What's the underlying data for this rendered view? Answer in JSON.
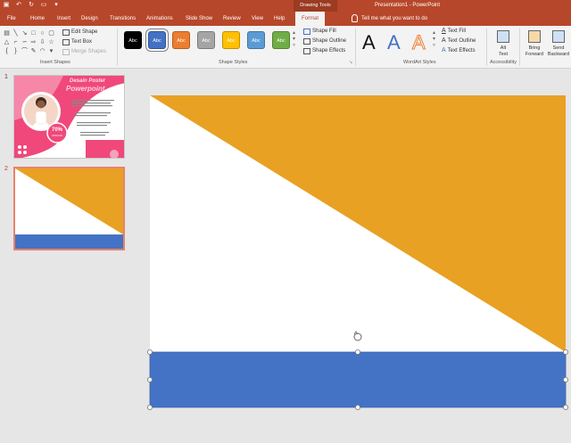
{
  "app": {
    "title": "Presentation1  -  PowerPoint",
    "context_tab_group": "Drawing Tools",
    "tell_me": "Tell me what you want to do"
  },
  "tabs": [
    {
      "label": "File"
    },
    {
      "label": "Home"
    },
    {
      "label": "Insert"
    },
    {
      "label": "Design"
    },
    {
      "label": "Transitions"
    },
    {
      "label": "Animations"
    },
    {
      "label": "Slide Show"
    },
    {
      "label": "Review"
    },
    {
      "label": "View"
    },
    {
      "label": "Help"
    },
    {
      "label": "Format"
    }
  ],
  "ribbon": {
    "insert_shapes": {
      "label": "Insert Shapes",
      "edit_shape": "Edit Shape",
      "text_box": "Text Box",
      "merge_shapes": "Merge Shapes"
    },
    "shape_styles": {
      "label": "Shape Styles",
      "swatch_text": "Abc",
      "swatches": [
        "#000000",
        "#4472c4",
        "#ed7d31",
        "#a5a5a5",
        "#ffc000",
        "#5b9bd5",
        "#70ad47"
      ],
      "shape_fill": "Shape Fill",
      "shape_outline": "Shape Outline",
      "shape_effects": "Shape Effects"
    },
    "wordart_styles": {
      "label": "WordArt Styles",
      "letter": "A",
      "text_fill": "Text Fill",
      "text_outline": "Text Outline",
      "text_effects": "Text Effects"
    },
    "accessibility": {
      "label": "Accessibility",
      "alt_text_l1": "Alt",
      "alt_text_l2": "Text"
    },
    "arrange": {
      "bring_forward_l1": "Bring",
      "bring_forward_l2": "Forward",
      "send_backward_l1": "Send",
      "send_backward_l2": "Backward"
    }
  },
  "slides": [
    {
      "number": "1",
      "title_line1": "Desain Poster",
      "title_line2": "Powerpoint",
      "badge_pct": "70%",
      "badge_sub": "DISKON"
    },
    {
      "number": "2"
    }
  ],
  "colors": {
    "ribbon_red": "#b7472a",
    "triangle": "#e8a122",
    "rectangle": "#4472c4",
    "pink": "#f0487a"
  }
}
